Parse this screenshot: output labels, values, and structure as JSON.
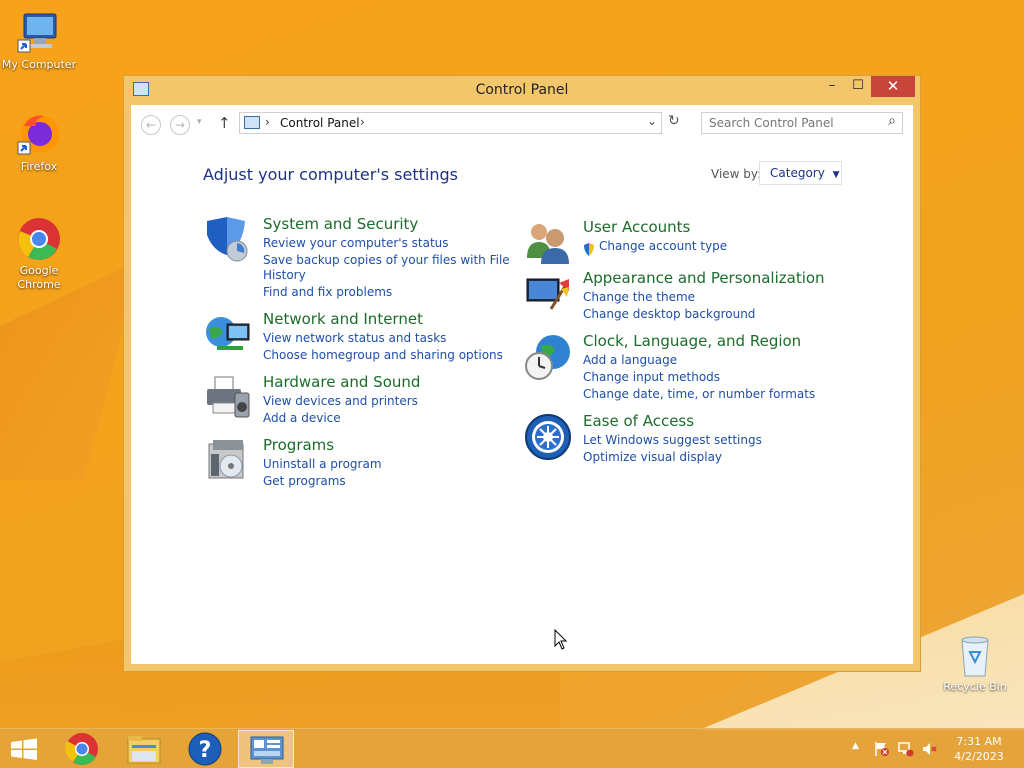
{
  "desktop": {
    "icons": [
      {
        "label": "My Computer"
      },
      {
        "label": "Firefox"
      },
      {
        "label": "Google Chrome"
      },
      {
        "label": "Recycle Bin"
      }
    ]
  },
  "window": {
    "title": "Control Panel",
    "controls": {
      "minimize": "–",
      "maximize": "☐",
      "close": "✕"
    },
    "nav": {
      "back": "←",
      "forward": "→",
      "recent": "▾",
      "up": "↑"
    },
    "address": {
      "breadcrumb": "Control Panel",
      "separator": "›",
      "dropdown": "⌄",
      "refresh": "↻"
    },
    "search": {
      "placeholder": "Search Control Panel",
      "icon": "⌕"
    },
    "heading": "Adjust your computer's settings",
    "view_by": {
      "label": "View by:",
      "value": "Category",
      "arrow": "▼"
    }
  },
  "categories": {
    "system": {
      "title": "System and Security",
      "links": [
        "Review your computer's status",
        "Save backup copies of your files with File",
        "History",
        "Find and fix problems"
      ]
    },
    "network": {
      "title": "Network and Internet",
      "links": [
        "View network status and tasks",
        "Choose homegroup and sharing options"
      ]
    },
    "hardware": {
      "title": "Hardware and Sound",
      "links": [
        "View devices and printers",
        "Add a device"
      ]
    },
    "programs": {
      "title": "Programs",
      "links": [
        "Uninstall a program",
        "Get programs"
      ]
    },
    "users": {
      "title": "User Accounts",
      "links": [
        "Change account type"
      ]
    },
    "appearance": {
      "title": "Appearance and Personalization",
      "links": [
        "Change the theme",
        "Change desktop background"
      ]
    },
    "clock": {
      "title": "Clock, Language, and Region",
      "links": [
        "Add a language",
        "Change input methods",
        "Change date, time, or number formats"
      ]
    },
    "ease": {
      "title": "Ease of Access",
      "links": [
        "Let Windows suggest settings",
        "Optimize visual display"
      ]
    }
  },
  "taskbar": {
    "clock": {
      "time": "7:31 AM",
      "date": "4/2/2023"
    },
    "tray_expand": "▲"
  },
  "colors": {
    "category_title": "#1c6c2b",
    "link": "#1e4fa8",
    "heading": "#1e3287",
    "close_button": "#c7453a"
  }
}
